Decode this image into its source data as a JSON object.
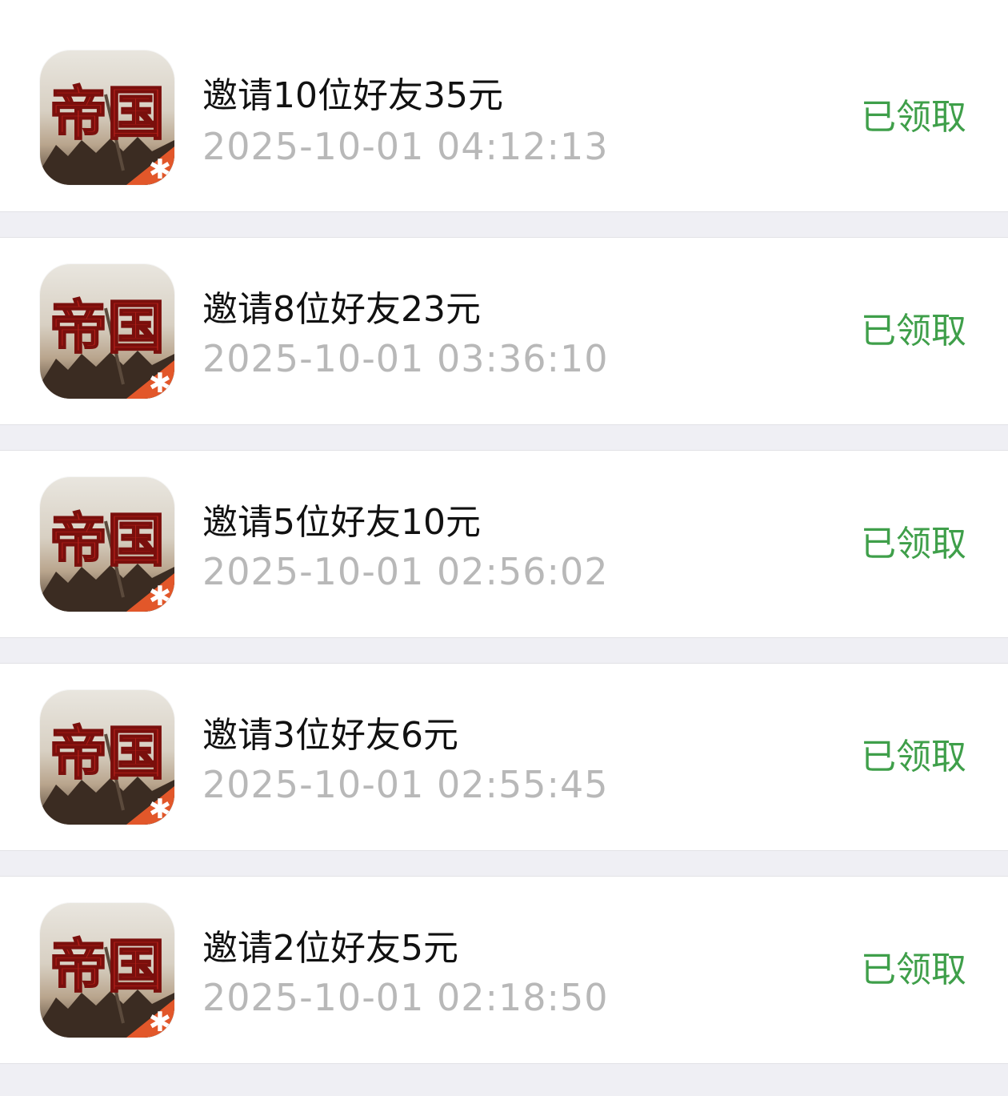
{
  "colors": {
    "background": "#efeff4",
    "card": "#ffffff",
    "title_text": "#111111",
    "time_text": "#b8b8b8",
    "status_green": "#3f9f4a",
    "icon_red": "#b5201a"
  },
  "records": [
    {
      "icon": "empire-game-icon",
      "icon_text": "帝国",
      "title": "邀请10位好友35元",
      "time": "2025-10-01 04:12:13",
      "status": "已领取"
    },
    {
      "icon": "empire-game-icon",
      "icon_text": "帝国",
      "title": "邀请8位好友23元",
      "time": "2025-10-01 03:36:10",
      "status": "已领取"
    },
    {
      "icon": "empire-game-icon",
      "icon_text": "帝国",
      "title": "邀请5位好友10元",
      "time": "2025-10-01 02:56:02",
      "status": "已领取"
    },
    {
      "icon": "empire-game-icon",
      "icon_text": "帝国",
      "title": "邀请3位好友6元",
      "time": "2025-10-01 02:55:45",
      "status": "已领取"
    },
    {
      "icon": "empire-game-icon",
      "icon_text": "帝国",
      "title": "邀请2位好友5元",
      "time": "2025-10-01 02:18:50",
      "status": "已领取"
    }
  ]
}
